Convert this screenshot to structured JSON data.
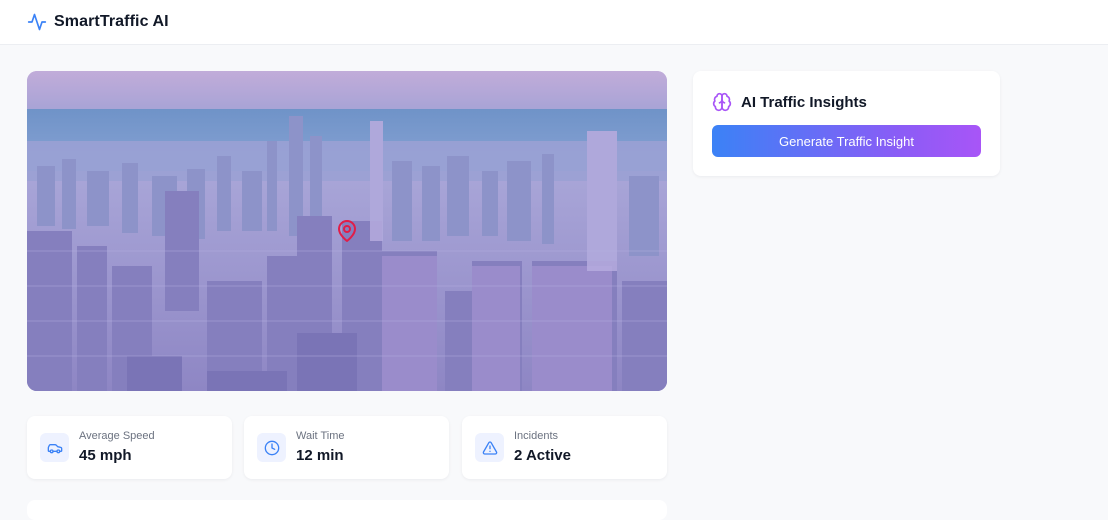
{
  "header": {
    "title": "SmartTraffic AI",
    "icon": "activity-icon"
  },
  "hero": {
    "image": "city-skyline-photo",
    "marker_icon": "map-pin-icon",
    "marker_color": "#e11d48"
  },
  "stats": [
    {
      "label": "Average Speed",
      "value": "45 mph",
      "icon": "car-icon"
    },
    {
      "label": "Wait Time",
      "value": "12 min",
      "icon": "clock-icon"
    },
    {
      "label": "Incidents",
      "value": "2 Active",
      "icon": "alert-triangle-icon"
    }
  ],
  "insights": {
    "title": "AI Traffic Insights",
    "icon": "brain-icon",
    "button_label": "Generate Traffic Insight",
    "gradient_start": "#3b82f6",
    "gradient_end": "#a855f7"
  },
  "colors": {
    "accent": "#3b82f6",
    "purple": "#a855f7"
  }
}
